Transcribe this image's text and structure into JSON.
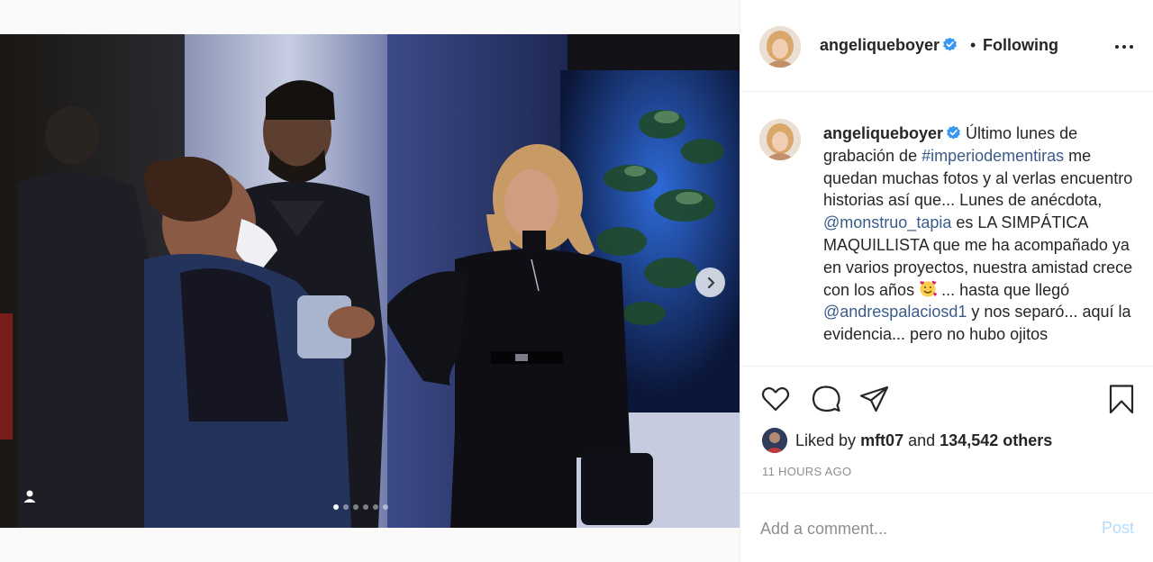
{
  "post": {
    "username": "angeliqueboyer",
    "separator": "•",
    "follow_status": "Following",
    "caption_parts": {
      "text1": "Último lunes de grabación de ",
      "hashtag": "#imperiodementiras",
      "text2": " me quedan muchas fotos y al verlas encuentro historias así que... Lunes de anécdota, ",
      "mention1": "@monstruo_tapia",
      "text3": " es LA SIMPÁTICA MAQUILLISTA que me ha acompañado ya en varios proyectos, nuestra amistad crece con los años ",
      "text4": " ... hasta que llegó ",
      "mention2": "@andrespalaciosd1",
      "text5": " y nos separó... aquí la evidencia... pero no hubo ojitos"
    },
    "liked_by_prefix": "Liked by ",
    "liked_by_user": "mft07",
    "liked_by_and": " and ",
    "liked_by_others": "134,542 others",
    "timestamp": "11 HOURS AGO"
  },
  "comment_box": {
    "placeholder": "Add a comment...",
    "post_label": "Post"
  },
  "carousel": {
    "count": 6,
    "active_index": 0
  },
  "colors": {
    "link": "#3b5c8a",
    "post_disabled": "#b3dbff",
    "verified": "#3897f0",
    "meta": "#8e8e8e"
  },
  "icons": [
    "verified-badge-icon",
    "more-options-icon",
    "heart-icon",
    "comment-icon",
    "share-icon",
    "bookmark-icon",
    "next-arrow-icon",
    "user-tag-icon"
  ]
}
